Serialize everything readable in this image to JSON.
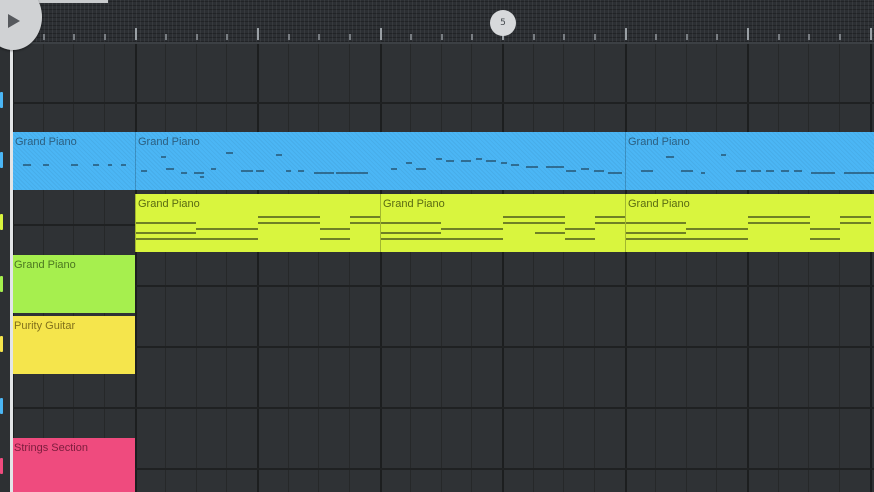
{
  "timeline": {
    "bar_marker": "5",
    "play_icon": "play-icon"
  },
  "colors": {
    "blue_track": "#4bb6f5",
    "lime_track": "#d9f53e",
    "green_track": "#a6ef4e",
    "yellow_track": "#f5e54c",
    "pink_track": "#ef4b7e",
    "background": "#2f3235"
  },
  "clips": [
    {
      "label": "Grand Piano"
    },
    {
      "label": "Grand Piano"
    },
    {
      "label": "Grand Piano"
    },
    {
      "label": "Grand Piano"
    },
    {
      "label": "Grand Piano"
    },
    {
      "label": "Grand Piano"
    },
    {
      "label": "Grand Piano"
    },
    {
      "label": "Purity Guitar"
    },
    {
      "label": "Strings Section"
    }
  ]
}
